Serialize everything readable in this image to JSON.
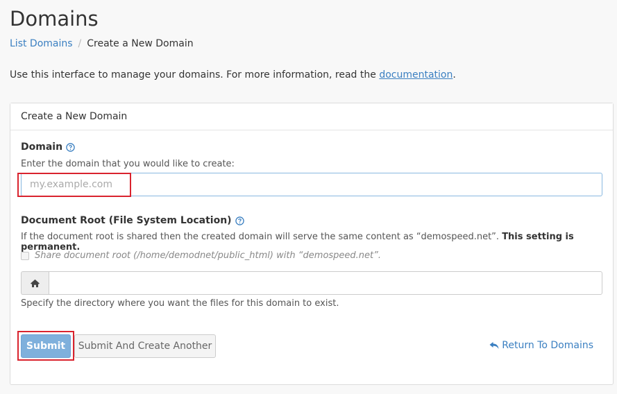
{
  "page": {
    "title": "Domains"
  },
  "breadcrumb": {
    "parent": "List Domains",
    "separator": "/",
    "current": "Create a New Domain"
  },
  "intro": {
    "text": "Use this interface to manage your domains. For more information, read the ",
    "link": "documentation",
    "suffix": "."
  },
  "panel": {
    "heading": "Create a New Domain",
    "domain": {
      "label": "Domain",
      "help": "Enter the domain that you would like to create:",
      "placeholder": "my.example.com",
      "value": ""
    },
    "docroot": {
      "label": "Document Root (File System Location)",
      "help": "If the document root is shared then the created domain will serve the same content as “demospeed.net”.",
      "help_bold": "This setting is permanent.",
      "share_label": "Share document root (/home/demodnet/public_html) with “demospeed.net”.",
      "share_checked": false,
      "value": "",
      "hint": "Specify the directory where you want the files for this domain to exist."
    },
    "actions": {
      "submit": "Submit",
      "submit_another": "Submit And Create Another",
      "return": "Return To Domains"
    }
  },
  "colors": {
    "link": "#3a7fc1",
    "primary_button": "#7fb0dc",
    "highlight": "#d9232e"
  },
  "icons": {
    "help": "question-circle-icon",
    "home": "home-icon",
    "return": "reply-arrow-icon"
  }
}
